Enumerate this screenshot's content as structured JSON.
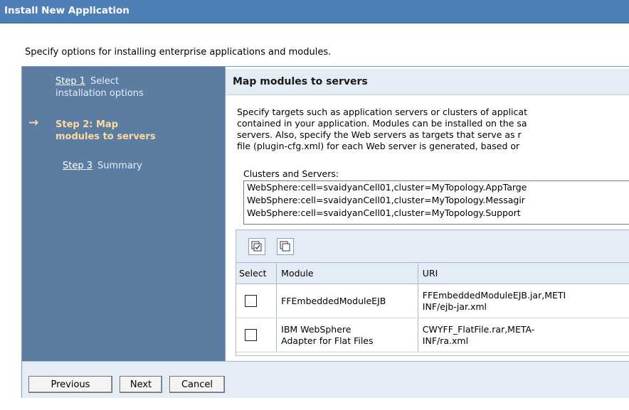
{
  "window": {
    "title": "Install New Application"
  },
  "intro": "Specify options for installing enterprise applications and modules.",
  "steps": [
    {
      "link": "Step 1",
      "text": "Select installation options",
      "line1": "Select",
      "line2": "installation options"
    },
    {
      "text": "Step 2: Map modules to servers",
      "line1": "Step 2: Map",
      "line2": "modules to servers",
      "current": true
    },
    {
      "link": "Step 3",
      "text": "Summary"
    }
  ],
  "main": {
    "heading": "Map modules to servers",
    "description_lines": [
      "Specify targets such as application servers or clusters of applicat",
      "contained in your application. Modules can be installed on the sa",
      "servers. Also, specify the Web servers as targets that serve as r",
      "file (plugin-cfg.xml) for each Web server is generated, based or"
    ],
    "clusters_label": "Clusters and Servers:",
    "clusters": [
      "WebSphere:cell=svaidyanCell01,cluster=MyTopology.AppTarge",
      "WebSphere:cell=svaidyanCell01,cluster=MyTopology.Messagir",
      "WebSphere:cell=svaidyanCell01,cluster=MyTopology.Support"
    ]
  },
  "table": {
    "toolbar_icons": [
      "select-all-icon",
      "deselect-all-icon"
    ],
    "columns": [
      "Select",
      "Module",
      "URI"
    ],
    "rows": [
      {
        "module_l1": "FFEmbeddedModuleEJB",
        "module_l2": "",
        "uri_l1": "FFEmbeddedModuleEJB.jar,METI",
        "uri_l2": "INF/ejb-jar.xml",
        "checked": false
      },
      {
        "module_l1": "IBM WebSphere",
        "module_l2": "Adapter for Flat Files",
        "uri_l1": "CWYFF_FlatFile.rar,META-",
        "uri_l2": "INF/ra.xml",
        "checked": false
      }
    ]
  },
  "buttons": {
    "previous": "Previous",
    "next": "Next",
    "cancel": "Cancel"
  },
  "colors": {
    "title_bar": "#4f7fb7",
    "sidebar": "#5c7da2",
    "current_step": "#ffd9a0",
    "header_band": "#e4ecf5"
  }
}
